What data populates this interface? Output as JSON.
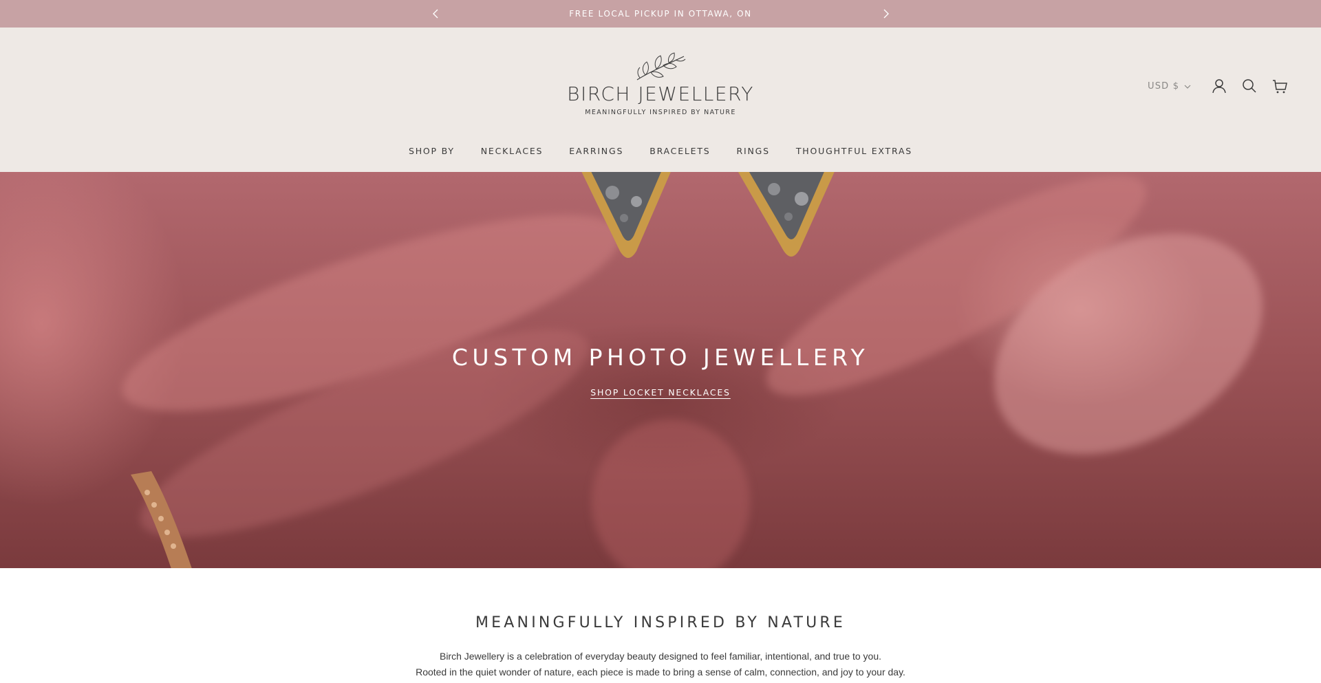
{
  "announcement": {
    "text": "FREE LOCAL PICKUP IN OTTAWA, ON",
    "prev_icon": "chevron-left-icon",
    "next_icon": "chevron-right-icon"
  },
  "header": {
    "logo_name": "BIRCH JEWELLERY",
    "logo_tagline": "MEANINGFULLY INSPIRED BY NATURE",
    "currency": "USD $",
    "icons": [
      "account-icon",
      "search-icon",
      "cart-icon"
    ]
  },
  "nav": {
    "items": [
      "SHOP BY",
      "NECKLACES",
      "EARRINGS",
      "BRACELETS",
      "RINGS",
      "THOUGHTFUL EXTRAS"
    ]
  },
  "hero": {
    "title": "CUSTOM PHOTO JEWELLERY",
    "link": "SHOP LOCKET NECKLACES"
  },
  "about": {
    "title": "MEANINGFULLY INSPIRED BY NATURE",
    "line1": "Birch Jewellery is a celebration of everyday beauty designed to feel familiar, intentional, and true to you.",
    "line2": "Rooted in the quiet wonder of nature, each piece is made to bring a sense of calm, connection, and joy to your day."
  },
  "colors": {
    "announcement_bg": "#c7a2a4",
    "header_bg": "#eee9e5",
    "text": "#3a3a3a"
  }
}
